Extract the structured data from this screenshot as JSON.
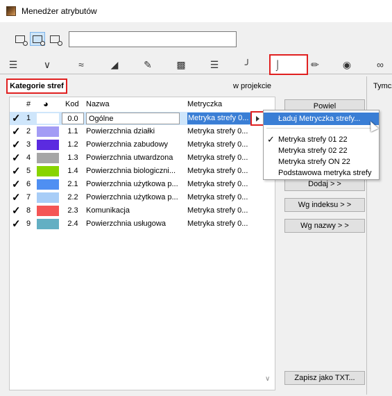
{
  "window": {
    "title": "Menedżer atrybutów"
  },
  "panel": {
    "title": "Kategorie stref",
    "in_project": "w projekcie",
    "right_label": "Tymcz"
  },
  "columns": {
    "num": "#",
    "color": "",
    "code": "Kod",
    "name": "Nazwa",
    "metric": "Metryczka"
  },
  "rows": [
    {
      "check": "✓",
      "num": "1",
      "color": "#ffffff",
      "code": "0.0",
      "name": "Ogólne",
      "metric": "Metryka strefy 0..."
    },
    {
      "check": "✓",
      "num": "2",
      "color": "#a39cf5",
      "code": "1.1",
      "name": "Powierzchnia działki",
      "metric": "Metryka strefy 0..."
    },
    {
      "check": "✓",
      "num": "3",
      "color": "#5b2be0",
      "code": "1.2",
      "name": "Powierzchnia zabudowy",
      "metric": "Metryka strefy 0..."
    },
    {
      "check": "✓",
      "num": "4",
      "color": "#a6a6a6",
      "code": "1.3",
      "name": "Powierzchnia utwardzona",
      "metric": "Metryka strefy 0..."
    },
    {
      "check": "✓",
      "num": "5",
      "color": "#88d400",
      "code": "1.4",
      "name": "Powierzchnia biologiczni...",
      "metric": "Metryka strefy 0..."
    },
    {
      "check": "✓",
      "num": "6",
      "color": "#4f8ff2",
      "code": "2.1",
      "name": "Powierzchnia użytkowa p...",
      "metric": "Metryka strefy 0..."
    },
    {
      "check": "✓",
      "num": "7",
      "color": "#a8cdf7",
      "code": "2.2",
      "name": "Powierzchnia użytkowa p...",
      "metric": "Metryka strefy 0..."
    },
    {
      "check": "✓",
      "num": "8",
      "color": "#f45555",
      "code": "2.3",
      "name": "Komunikacja",
      "metric": "Metryka strefy 0..."
    },
    {
      "check": "✓",
      "num": "9",
      "color": "#63afc3",
      "code": "2.4",
      "name": "Powierzchnia usługowa",
      "metric": "Metryka strefy 0..."
    }
  ],
  "buttons": {
    "duplicate": "Powiel",
    "add": "Dodaj > >",
    "by_index": "Wg indeksu > >",
    "by_name": "Wg nazwy > >",
    "save_txt": "Zapisz jako TXT..."
  },
  "menu": {
    "load": "Ładuj Metryczka strefy...",
    "items": [
      {
        "label": "Metryka strefy 01 22",
        "check": "✓"
      },
      {
        "label": "Metryka strefy 02 22",
        "check": ""
      },
      {
        "label": "Metryka strefy ON 22",
        "check": ""
      },
      {
        "label": "Podstawowa metryka strefy",
        "check": ""
      }
    ]
  },
  "search": {
    "value": ""
  },
  "icons": {
    "tabs": [
      "layers-icon",
      "pen-icon",
      "line-type-icon",
      "fill-icon",
      "surface-icon",
      "composite-icon",
      "profile-icon",
      "column-icon",
      "zone-category-icon",
      "pencil-icon",
      "globe-icon",
      "mep-icon"
    ]
  },
  "colors": {
    "accent": "#3a7ed5",
    "highlight_border": "#e02020"
  }
}
